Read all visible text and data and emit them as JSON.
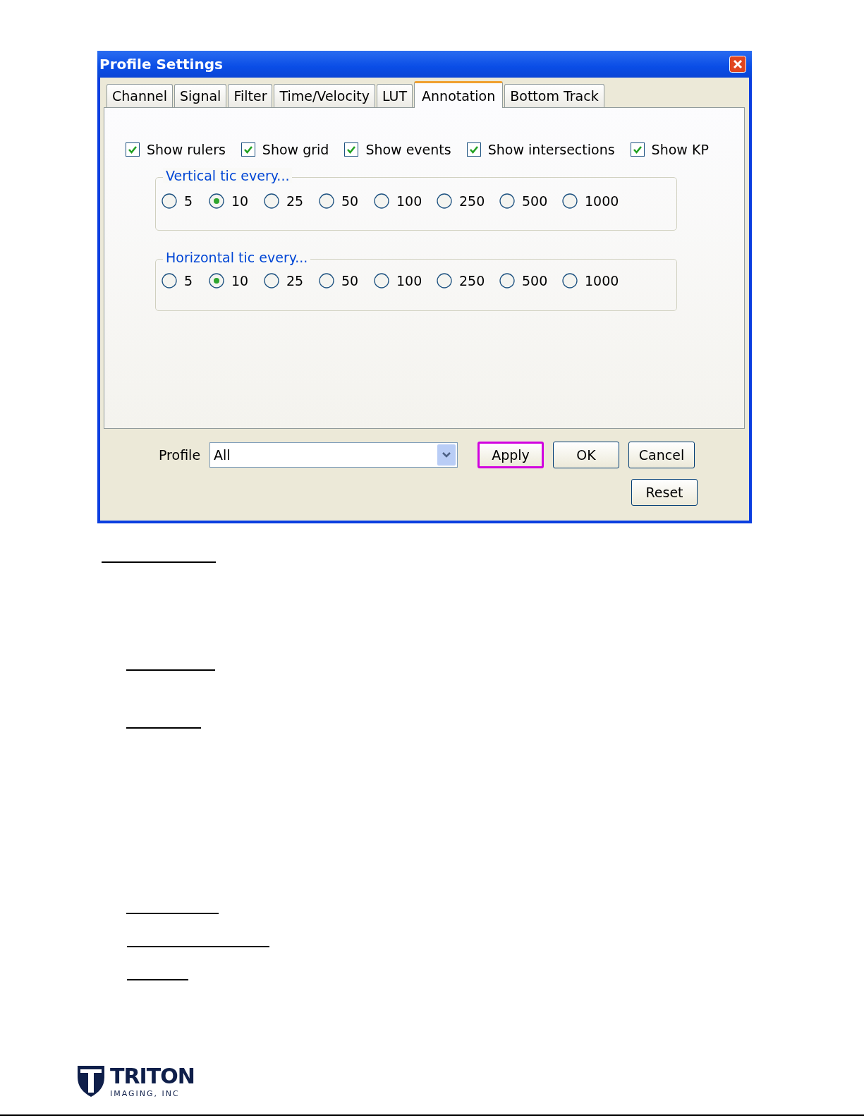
{
  "window": {
    "title": "Profile Settings"
  },
  "tabs": [
    {
      "label": "Channel",
      "selected": false
    },
    {
      "label": "Signal",
      "selected": false
    },
    {
      "label": "Filter",
      "selected": false
    },
    {
      "label": "Time/Velocity",
      "selected": false
    },
    {
      "label": "LUT",
      "selected": false
    },
    {
      "label": "Annotation",
      "selected": true
    },
    {
      "label": "Bottom Track",
      "selected": false
    }
  ],
  "checkboxes": [
    {
      "label": "Show rulers",
      "checked": true
    },
    {
      "label": "Show grid",
      "checked": true
    },
    {
      "label": "Show events",
      "checked": true
    },
    {
      "label": "Show intersections",
      "checked": true
    },
    {
      "label": "Show KP",
      "checked": true
    }
  ],
  "groups": [
    {
      "title": "Vertical tic every...",
      "options": [
        {
          "label": "5",
          "selected": false
        },
        {
          "label": "10",
          "selected": true
        },
        {
          "label": "25",
          "selected": false
        },
        {
          "label": "50",
          "selected": false
        },
        {
          "label": "100",
          "selected": false
        },
        {
          "label": "250",
          "selected": false
        },
        {
          "label": "500",
          "selected": false
        },
        {
          "label": "1000",
          "selected": false
        }
      ]
    },
    {
      "title": "Horizontal tic every...",
      "options": [
        {
          "label": "5",
          "selected": false
        },
        {
          "label": "10",
          "selected": true
        },
        {
          "label": "25",
          "selected": false
        },
        {
          "label": "50",
          "selected": false
        },
        {
          "label": "100",
          "selected": false
        },
        {
          "label": "250",
          "selected": false
        },
        {
          "label": "500",
          "selected": false
        },
        {
          "label": "1000",
          "selected": false
        }
      ]
    }
  ],
  "profile": {
    "label": "Profile",
    "value": "All"
  },
  "buttons": [
    {
      "label": "Apply",
      "highlighted": true
    },
    {
      "label": "OK",
      "highlighted": false
    },
    {
      "label": "Cancel",
      "highlighted": false
    }
  ],
  "reset_button": {
    "label": "Reset"
  },
  "logo": {
    "name": "TRITON",
    "subtitle": "IMAGING, INC"
  }
}
